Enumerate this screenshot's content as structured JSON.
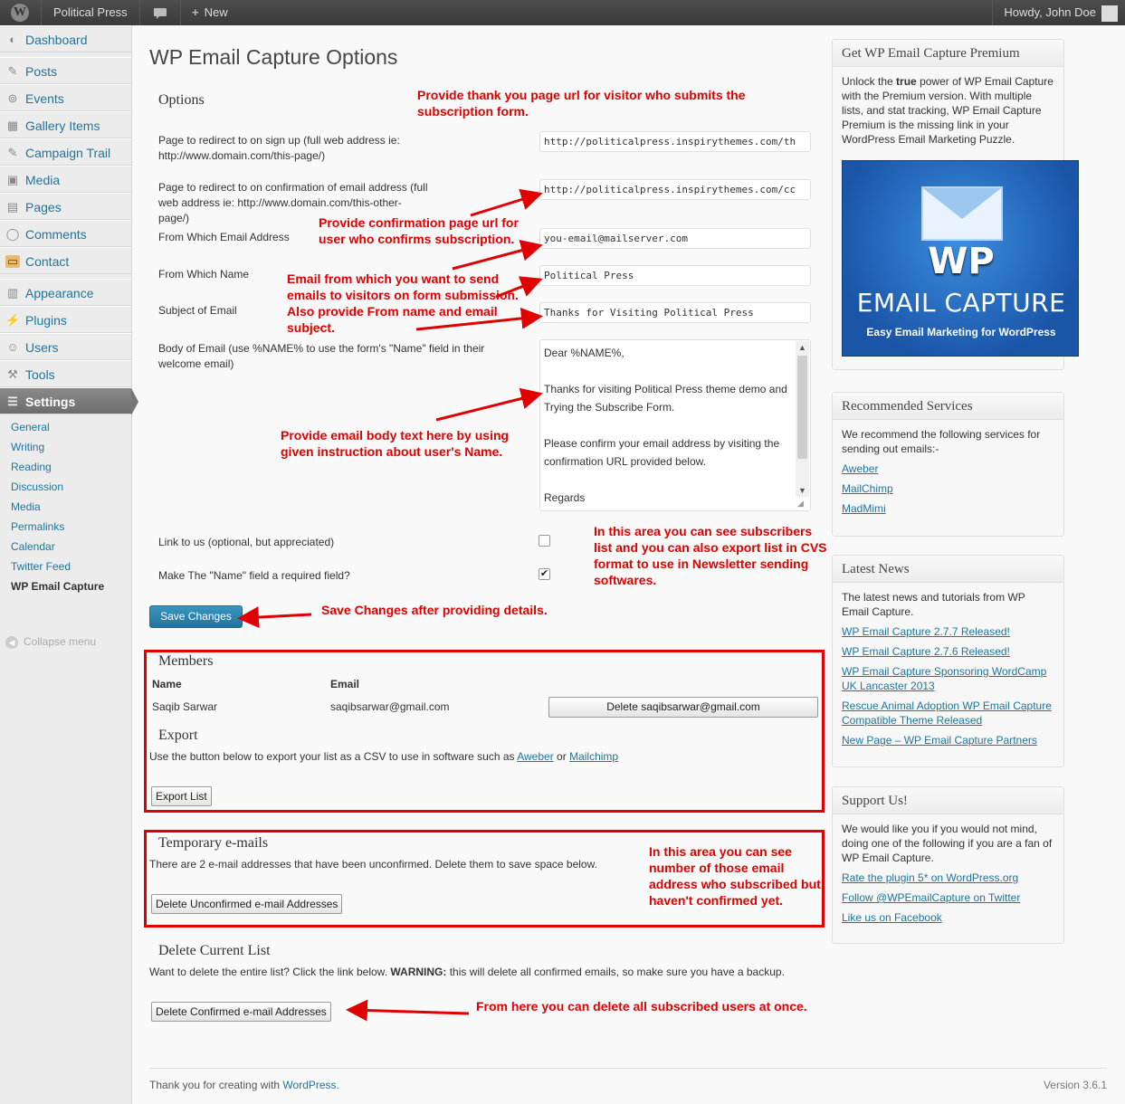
{
  "adminbar": {
    "site_name": "Political Press",
    "new_label": "New",
    "howdy": "Howdy, John Doe"
  },
  "sidebar": {
    "menu": [
      {
        "label": "Dashboard",
        "icon": "dashboard-icon"
      },
      {
        "label": "Posts",
        "icon": "pin-icon"
      },
      {
        "label": "Events",
        "icon": "events-icon"
      },
      {
        "label": "Gallery Items",
        "icon": "grid-icon"
      },
      {
        "label": "Campaign Trail",
        "icon": "pin-icon"
      },
      {
        "label": "Media",
        "icon": "media-icon"
      },
      {
        "label": "Pages",
        "icon": "pages-icon"
      },
      {
        "label": "Comments",
        "icon": "comment-icon"
      },
      {
        "label": "Contact",
        "icon": "contact-icon"
      },
      {
        "label": "Appearance",
        "icon": "appearance-icon"
      },
      {
        "label": "Plugins",
        "icon": "plugin-icon"
      },
      {
        "label": "Users",
        "icon": "users-icon"
      },
      {
        "label": "Tools",
        "icon": "tools-icon"
      },
      {
        "label": "Settings",
        "icon": "settings-icon"
      }
    ],
    "submenu": [
      "General",
      "Writing",
      "Reading",
      "Discussion",
      "Media",
      "Permalinks",
      "Calendar",
      "Twitter Feed",
      "WP Email Capture"
    ],
    "collapse": "Collapse menu"
  },
  "main": {
    "title": "WP Email Capture Options",
    "options_heading": "Options",
    "fields": {
      "redirect_signup_label": "Page to redirect to on sign up (full web address ie: http://www.domain.com/this-page/)",
      "redirect_signup_value": "http://politicalpress.inspirythemes.com/th",
      "redirect_confirm_label": "Page to redirect to on confirmation of email address (full web address ie: http://www.domain.com/this-other-page/)",
      "redirect_confirm_value": "http://politicalpress.inspirythemes.com/cc",
      "from_email_label": "From Which Email Address",
      "from_email_value": "you-email@mailserver.com",
      "from_name_label": "From Which Name",
      "from_name_value": "Political Press",
      "subject_label": "Subject of Email",
      "subject_value": "Thanks for Visiting Political Press",
      "body_label": "Body of Email (use %NAME% to use the form's \"Name\" field in their welcome email)",
      "body_value": "Dear %NAME%,\n\nThanks for visiting Political Press theme demo and Trying the Subscribe Form.\n\nPlease confirm your email address by visiting the confirmation URL provided below.\n\nRegards",
      "link_label": "Link to us (optional, but appreciated)",
      "link_checked": false,
      "name_required_label": "Make The \"Name\" field a required field?",
      "name_required_checked": true
    },
    "save_label": "Save Changes",
    "members": {
      "heading": "Members",
      "col_name": "Name",
      "col_email": "Email",
      "rows": [
        {
          "name": "Saqib Sarwar",
          "email": "saqibsarwar@gmail.com",
          "delete_label": "Delete saqibsarwar@gmail.com"
        }
      ]
    },
    "export": {
      "heading": "Export",
      "text_before": "Use the button below to export your list as a CSV to use in software such as",
      "link1": "Aweber",
      "text_or": "or",
      "link2": "Mailchimp",
      "button": "Export List"
    },
    "temporary": {
      "heading": "Temporary e-mails",
      "text": "There are 2 e-mail addresses that have been unconfirmed. Delete them to save space below.",
      "button": "Delete Unconfirmed e-mail Addresses"
    },
    "delete_list": {
      "heading": "Delete Current List",
      "text_before": "Want to delete the entire list? Click the link below.",
      "warning": "WARNING:",
      "text_after": "this will delete all confirmed emails, so make sure you have a backup.",
      "button": "Delete Confirmed e-mail Addresses"
    }
  },
  "annotations": {
    "thank_you": "Provide thank you page url for visitor who submits the subscription form.",
    "confirmation": "Provide confirmation page url for user who confirms subscription.",
    "from_email": "Email from which you want to send emails to visitors on form submission. Also provide From name and email subject.",
    "body": "Provide email body text here by using given instruction about user's Name.",
    "subscribers": "In this area you can see subscribers list and you can also export list in CVS format to use in Newsletter sending softwares.",
    "save": "Save Changes after providing details.",
    "unconfirmed": "In this area you can see number of those email address who subscribed but haven't confirmed yet.",
    "delete_all": "From here you can delete all subscribed users at once."
  },
  "right": {
    "premium": {
      "heading": "Get WP Email Capture Premium",
      "text_before": "Unlock the",
      "text_bold": "true",
      "text_after": "power of WP Email Capture with the Premium version. With multiple lists, and stat tracking, WP Email Capture Premium is the missing link in your WordPress Email Marketing Puzzle.",
      "img_wp": "WP",
      "img_ec": "EMAIL CAPTURE",
      "img_tag": "Easy Email Marketing for WordPress"
    },
    "recommended": {
      "heading": "Recommended Services",
      "text": "We recommend the following services for sending out emails:-",
      "links": [
        "Aweber",
        "MailChimp",
        "MadMimi"
      ]
    },
    "news": {
      "heading": "Latest News",
      "text": "The latest news and tutorials from WP Email Capture.",
      "links": [
        "WP Email Capture 2.7.7 Released!",
        "WP Email Capture 2.7.6 Released!",
        "WP Email Capture Sponsoring WordCamp UK Lancaster 2013",
        "Rescue Animal Adoption WP Email Capture Compatible Theme Released",
        "New Page – WP Email Capture Partners"
      ]
    },
    "support": {
      "heading": "Support Us!",
      "text": "We would like you if you would not mind, doing one of the following if you are a fan of WP Email Capture.",
      "links": [
        "Rate the plugin 5* on WordPress.org",
        "Follow @WPEmailCapture on Twitter",
        "Like us on Facebook"
      ]
    }
  },
  "footer": {
    "thanks": "Thank you for creating with",
    "wp_link": "WordPress.",
    "version": "Version 3.6.1"
  },
  "colors": {
    "annotation": "#e00000",
    "link": "#21759b",
    "primary_button": "#21759b"
  }
}
